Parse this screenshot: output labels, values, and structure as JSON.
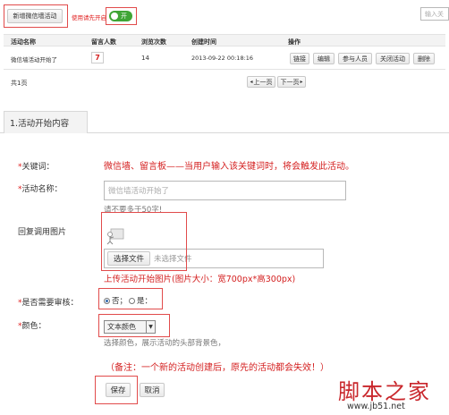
{
  "toolbar": {
    "new_button": "新增微信墙活动",
    "toggle_label": "使用请先开启",
    "toggle_state": "开",
    "search_placeholder": "输入关"
  },
  "table": {
    "headers": [
      "活动名称",
      "留言人数",
      "浏览次数",
      "创建时间",
      "操作"
    ],
    "row": {
      "name": "微信墙活动开始了",
      "messages": "7",
      "views": "14",
      "created": "2013-09-22 00:18:16",
      "actions": [
        "链接",
        "编辑",
        "参与人员",
        "关闭活动",
        "删除"
      ]
    }
  },
  "pager": {
    "total": "共1页",
    "prev": "上一页",
    "next": "下一页"
  },
  "section_tab": "1.活动开始内容",
  "form": {
    "keyword_label": "关键词：",
    "keyword_hint": "微信墙、留言板——当用户输入该关键词时，将会触发此活动。",
    "name_label": "活动名称：",
    "name_placeholder": "微信墙活动开始了",
    "name_hint": "请不要多于50字!",
    "image_label": "回复调用图片",
    "file_button": "选择文件",
    "file_status": "未选择文件",
    "upload_hint": "上传活动开始图片(图片大小：宽700px*高300px)",
    "review_label": "是否需要审核：",
    "review_no": "否；",
    "review_yes": "是：",
    "color_label": "颜色：",
    "color_select": "文本颜色",
    "color_hint": "选择颜色，展示活动的头部背景色，",
    "note": "（备注：一个新的活动创建后，原先的活动都会失效！）",
    "save_button": "保存",
    "cancel_button": "取消"
  },
  "watermark": {
    "title": "脚本之家",
    "url": "www.jb51.net"
  },
  "colors": {
    "accent_red": "#e14b4b",
    "toggle_green": "#3fa535",
    "count_red": "#d42020"
  }
}
